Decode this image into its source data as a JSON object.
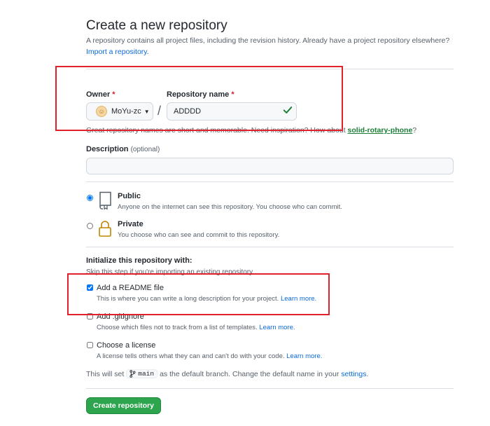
{
  "header": {
    "title": "Create a new repository",
    "subtitle": "A repository contains all project files, including the revision history. Already have a project repository elsewhere?",
    "import_link": "Import a repository."
  },
  "owner": {
    "label": "Owner",
    "required_mark": "*",
    "value": "MoYu-zc",
    "icon": "avatar"
  },
  "repo_name": {
    "label": "Repository name",
    "required_mark": "*",
    "value": "ADDDD",
    "status_icon": "check-icon",
    "valid_color": "#1a7f37"
  },
  "separator": "/",
  "name_hint": {
    "text": "Great repository names are short and memorable. Need inspiration? How about ",
    "suggestion": "solid-rotary-phone",
    "suffix": "?"
  },
  "description": {
    "label": "Description",
    "optional": "(optional)",
    "value": ""
  },
  "visibility": {
    "public": {
      "title": "Public",
      "desc": "Anyone on the internet can see this repository. You choose who can commit.",
      "checked": true,
      "icon": "repo-icon"
    },
    "private": {
      "title": "Private",
      "desc": "You choose who can see and commit to this repository.",
      "checked": false,
      "icon": "lock-icon"
    }
  },
  "initialize": {
    "title": "Initialize this repository with:",
    "skip_hint": "Skip this step if you're importing an existing repository.",
    "readme": {
      "label": "Add a README file",
      "desc": "This is where you can write a long description for your project.",
      "link": "Learn more.",
      "checked": true
    },
    "gitignore": {
      "label": "Add .gitignore",
      "desc": "Choose which files not to track from a list of templates.",
      "link": "Learn more.",
      "checked": false
    },
    "license": {
      "label": "Choose a license",
      "desc": "A license tells others what they can and can't do with your code.",
      "link": "Learn more.",
      "checked": false
    }
  },
  "branch_note": {
    "prefix": "This will set",
    "branch": "main",
    "middle": "as the default branch. Change the default name in your",
    "link": "settings",
    "suffix": "."
  },
  "submit": {
    "label": "Create repository",
    "color": "#2da44e"
  },
  "highlight_color": "#e0202a"
}
